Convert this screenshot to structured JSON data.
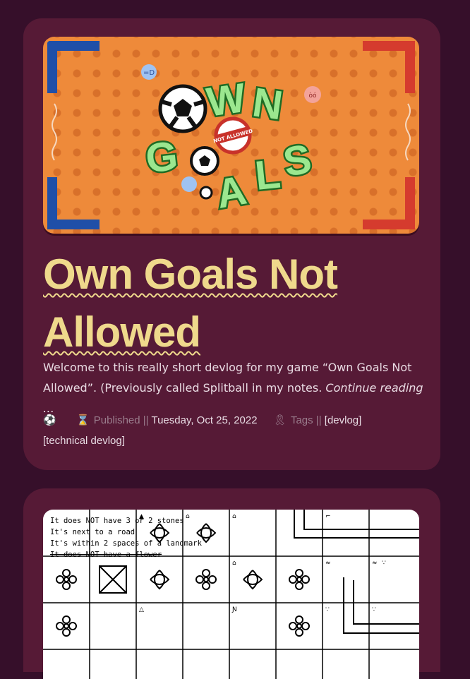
{
  "post1": {
    "hero_logo": {
      "words": [
        "O",
        "W",
        "N",
        "G",
        "O",
        "A",
        "L",
        "S"
      ],
      "badge": "NOT ALLOWED"
    },
    "title": "Own Goals Not Allowed",
    "excerpt": "Welcome to this really short devlog for my game “Own Goals Not Allowed”. (Previously called Splitball in my notes.",
    "continue": "Continue reading …",
    "meta": {
      "author_icon": "soccer-ball-icon",
      "published_icon": "hourglass-icon",
      "published_label": "Published ||",
      "date": "Tuesday, Oct 25, 2022",
      "tags_icon": "ribbon-icon",
      "tags_label": "Tags ||",
      "tags": [
        "[devlog]",
        "[technical devlog]"
      ]
    }
  },
  "post2": {
    "rules": [
      "It does NOT have 3 or 2 stones",
      "It's next to a road",
      "It's within 2 spaces of a landmark",
      "It does NOT have a flower"
    ]
  },
  "colors": {
    "page_bg": "#360f2a",
    "card_bg": "#561a36",
    "title": "#efd98c",
    "hero_orange": "#ee8a3a",
    "team_blue": "#1f4fa8",
    "team_red": "#d53b2e",
    "logo_green": "#9be78f"
  }
}
